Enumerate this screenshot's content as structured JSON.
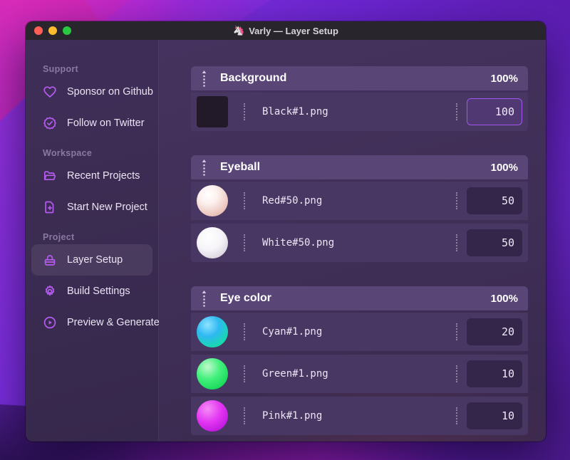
{
  "window": {
    "title": "Varly — Layer Setup",
    "app_icon": "🦄",
    "traffic_lights": [
      "close",
      "minimize",
      "zoom"
    ]
  },
  "sidebar": {
    "sections": [
      {
        "label": "Support",
        "items": [
          {
            "icon": "heart-icon",
            "label": "Sponsor on Github",
            "active": false
          },
          {
            "icon": "verified-badge-icon",
            "label": "Follow on Twitter",
            "active": false
          }
        ]
      },
      {
        "label": "Workspace",
        "items": [
          {
            "icon": "folder-icon",
            "label": "Recent Projects",
            "active": false
          },
          {
            "icon": "file-plus-icon",
            "label": "Start New Project",
            "active": false
          }
        ]
      },
      {
        "label": "Project",
        "items": [
          {
            "icon": "layers-bag-icon",
            "label": "Layer Setup",
            "active": true
          },
          {
            "icon": "gear-icon",
            "label": "Build Settings",
            "active": false
          },
          {
            "icon": "play-circle-icon",
            "label": "Preview & Generate",
            "active": false
          }
        ]
      }
    ]
  },
  "layer_setup": {
    "groups": [
      {
        "name": "Background",
        "weight": "100%",
        "rows": [
          {
            "thumb": "black-square-thumb",
            "file": "Black#1.png",
            "value": "100",
            "focused": true
          }
        ]
      },
      {
        "name": "Eyeball",
        "weight": "100%",
        "rows": [
          {
            "thumb": "red-sphere-thumb",
            "file": "Red#50.png",
            "value": "50",
            "focused": false
          },
          {
            "thumb": "white-sphere-thumb",
            "file": "White#50.png",
            "value": "50",
            "focused": false
          }
        ]
      },
      {
        "name": "Eye color",
        "weight": "100%",
        "rows": [
          {
            "thumb": "cyan-sphere-thumb",
            "file": "Cyan#1.png",
            "value": "20",
            "focused": false
          },
          {
            "thumb": "green-sphere-thumb",
            "file": "Green#1.png",
            "value": "10",
            "focused": false
          },
          {
            "thumb": "pink-sphere-thumb",
            "file": "Pink#1.png",
            "value": "10",
            "focused": false
          }
        ]
      }
    ]
  },
  "colors": {
    "accent": "#b55bf0",
    "focus-border": "#a256ee",
    "traffic-red": "#ff5f57",
    "traffic-yellow": "#febc2e",
    "traffic-green": "#28c840",
    "group-header-bg": "#5a4676",
    "row-bg": "#483663"
  }
}
